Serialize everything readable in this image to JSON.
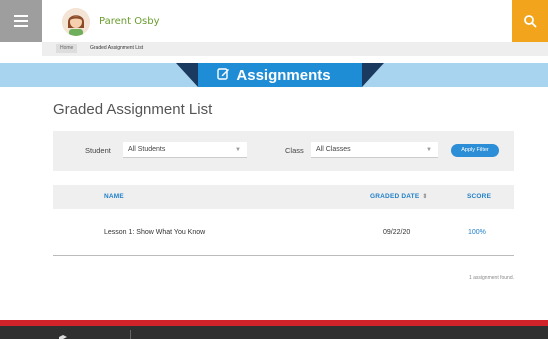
{
  "header": {
    "user_name": "Parent Osby",
    "menu_icon": "hamburger-menu-icon",
    "search_icon": "search-icon",
    "search_color": "#f2a51c"
  },
  "breadcrumb": {
    "items": [
      "Home",
      "Graded Assignment List"
    ]
  },
  "section": {
    "title": "Assignments",
    "icon": "edit-icon",
    "band_color": "#1f8dd6"
  },
  "page_title": "Graded Assignment List",
  "filters": {
    "student_label": "Student",
    "student_value": "All Students",
    "class_label": "Class",
    "class_value": "All Classes",
    "apply_label": "Apply Filter"
  },
  "table": {
    "columns": [
      "NAME",
      "GRADED DATE",
      "SCORE"
    ],
    "rows": [
      {
        "name": "Lesson 1: Show What You Know",
        "graded_date": "09/22/20",
        "score": "100%"
      }
    ],
    "footer_text": "1 assignment found."
  },
  "colors": {
    "accent_blue": "#1f7fc8",
    "footer_red": "#d2232a",
    "footer_dark": "#303030"
  }
}
